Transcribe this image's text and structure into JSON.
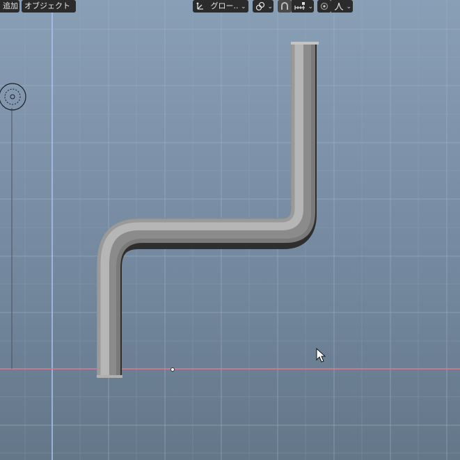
{
  "header": {
    "menu_add": "追加",
    "menu_object": "オブジェクト",
    "transform_orientation": "グロー..",
    "icons": {
      "orientation": "transform-orientation-icon",
      "pivot": "pivot-point-icon",
      "snap": "snap-magnet-icon",
      "snap_increment": "snap-increment-icon",
      "proportional": "proportional-editing-icon",
      "falloff": "falloff-curve-icon"
    }
  },
  "viewport": {
    "x_axis_color": "#e0788a",
    "y_axis_color": "#a4c2ee",
    "grid_color": "#9fb2c6",
    "pipe_color": "#9d9d9d"
  }
}
